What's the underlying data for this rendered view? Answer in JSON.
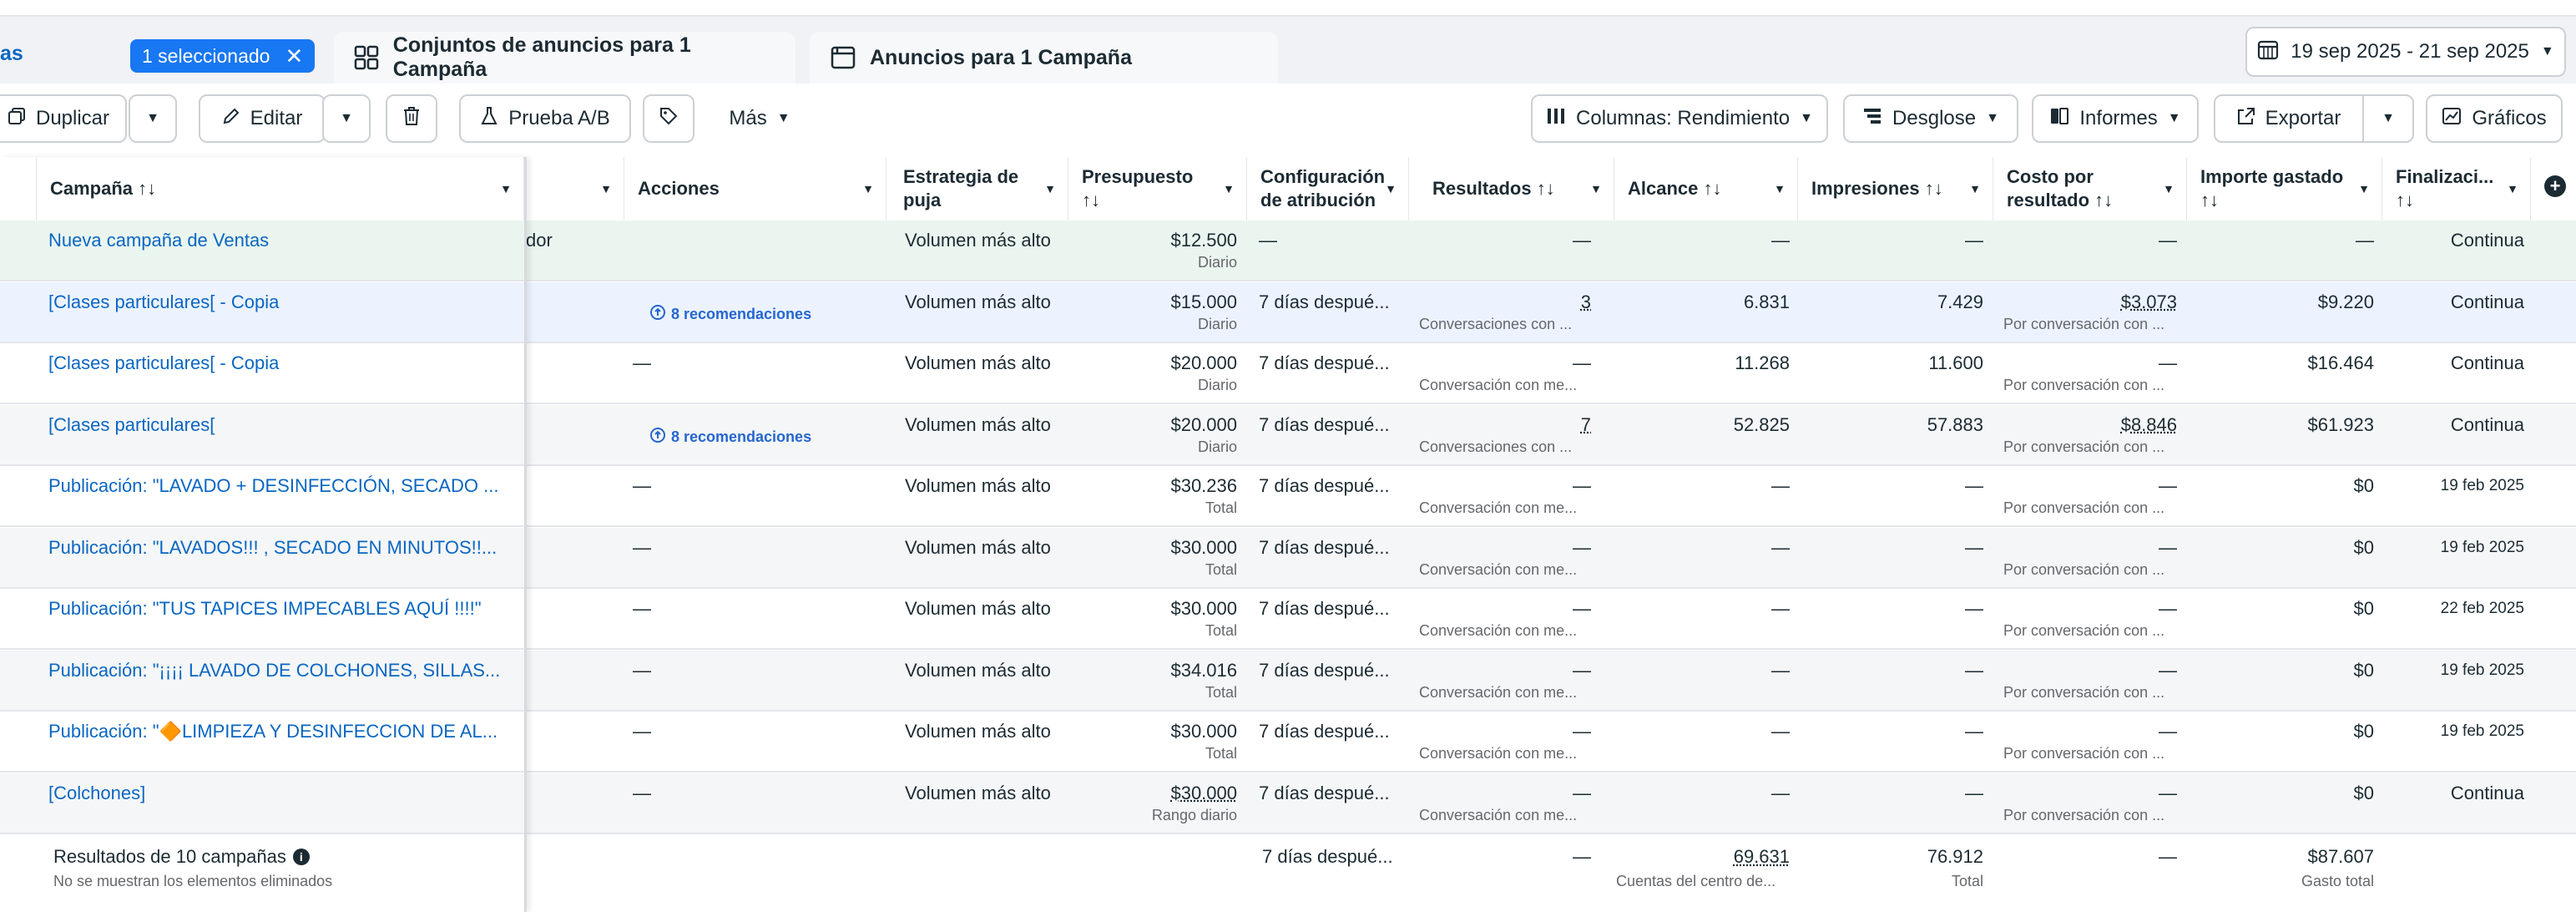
{
  "tabs": {
    "partial_label": "as",
    "selected_badge": "1 seleccionado",
    "ad_sets_tab": "Conjuntos de anuncios para 1 Campaña",
    "ads_tab": "Anuncios para 1 Campaña",
    "date_range": "19 sep 2025 - 21 sep 2025"
  },
  "toolbar": {
    "duplicate": "Duplicar",
    "edit": "Editar",
    "ab_test": "Prueba A/B",
    "more": "Más",
    "columns": "Columnas: Rendimiento",
    "breakdown": "Desglose",
    "reports": "Informes",
    "export": "Exportar",
    "charts": "Gráficos"
  },
  "headers": {
    "campaign": "Campaña ↑↓",
    "actions": "Acciones",
    "bid_strategy_1": "Estrategia de",
    "bid_strategy_2": "puja",
    "budget_1": "Presupuesto",
    "budget_2": "↑↓",
    "attribution_1": "Configuración",
    "attribution_2": "de atribución",
    "results": "Resultados ↑↓",
    "reach": "Alcance ↑↓",
    "impressions": "Impresiones ↑↓",
    "cost_1": "Costo por",
    "cost_2": "resultado ↑↓",
    "spent_1": "Importe gastado",
    "spent_2": "↑↓",
    "end_1": "Finalizaci...",
    "end_2": "↑↓"
  },
  "rows": [
    {
      "name": "Nueva campaña de Ventas",
      "hidden": "dor",
      "actions": "",
      "rec": "",
      "bid": "Volumen más alto",
      "budget": "$12.500",
      "budget_sub": "Diario",
      "attr": "—",
      "results": "—",
      "results_sub": "",
      "reach": "—",
      "impr": "—",
      "cost": "—",
      "cost_sub": "",
      "spent": "—",
      "end": "Continua"
    },
    {
      "name": "[Clases particulares[ - Copia",
      "hidden": "",
      "actions": "",
      "rec": "8 recomendaciones",
      "bid": "Volumen más alto",
      "budget": "$15.000",
      "budget_sub": "Diario",
      "attr": "7 días despué...",
      "results": "3",
      "results_sub": "Conversaciones con ...",
      "reach": "6.831",
      "impr": "7.429",
      "cost": "$3.073",
      "cost_sub": "Por conversación con ...",
      "spent": "$9.220",
      "end": "Continua"
    },
    {
      "name": "[Clases particulares[ - Copia",
      "hidden": "",
      "actions": "—",
      "rec": "",
      "bid": "Volumen más alto",
      "budget": "$20.000",
      "budget_sub": "Diario",
      "attr": "7 días despué...",
      "results": "—",
      "results_sub": "Conversación con me...",
      "reach": "11.268",
      "impr": "11.600",
      "cost": "—",
      "cost_sub": "Por conversación con ...",
      "spent": "$16.464",
      "end": "Continua"
    },
    {
      "name": "[Clases particulares[",
      "hidden": "",
      "actions": "",
      "rec": "8 recomendaciones",
      "bid": "Volumen más alto",
      "budget": "$20.000",
      "budget_sub": "Diario",
      "attr": "7 días despué...",
      "results": "7",
      "results_sub": "Conversaciones con ...",
      "reach": "52.825",
      "impr": "57.883",
      "cost": "$8.846",
      "cost_sub": "Por conversación con ...",
      "spent": "$61.923",
      "end": "Continua"
    },
    {
      "name": "Publicación: \"LAVADO + DESINFECCIÓN, SECADO ...",
      "hidden": "",
      "actions": "—",
      "rec": "",
      "bid": "Volumen más alto",
      "budget": "$30.236",
      "budget_sub": "Total",
      "attr": "7 días despué...",
      "results": "—",
      "results_sub": "Conversación con me...",
      "reach": "—",
      "impr": "—",
      "cost": "—",
      "cost_sub": "Por conversación con ...",
      "spent": "$0",
      "end": "19 feb 2025"
    },
    {
      "name": "Publicación: \"LAVADOS!!! , SECADO EN MINUTOS!!...",
      "hidden": "",
      "actions": "—",
      "rec": "",
      "bid": "Volumen más alto",
      "budget": "$30.000",
      "budget_sub": "Total",
      "attr": "7 días despué...",
      "results": "—",
      "results_sub": "Conversación con me...",
      "reach": "—",
      "impr": "—",
      "cost": "—",
      "cost_sub": "Por conversación con ...",
      "spent": "$0",
      "end": "19 feb 2025"
    },
    {
      "name": "Publicación: \"TUS TAPICES IMPECABLES AQUÍ !!!!\"",
      "hidden": "",
      "actions": "—",
      "rec": "",
      "bid": "Volumen más alto",
      "budget": "$30.000",
      "budget_sub": "Total",
      "attr": "7 días despué...",
      "results": "—",
      "results_sub": "Conversación con me...",
      "reach": "—",
      "impr": "—",
      "cost": "—",
      "cost_sub": "Por conversación con ...",
      "spent": "$0",
      "end": "22 feb 2025"
    },
    {
      "name": "Publicación: \"¡¡¡¡ LAVADO DE COLCHONES, SILLAS...",
      "hidden": "",
      "actions": "—",
      "rec": "",
      "bid": "Volumen más alto",
      "budget": "$34.016",
      "budget_sub": "Total",
      "attr": "7 días despué...",
      "results": "—",
      "results_sub": "Conversación con me...",
      "reach": "—",
      "impr": "—",
      "cost": "—",
      "cost_sub": "Por conversación con ...",
      "spent": "$0",
      "end": "19 feb 2025"
    },
    {
      "name": "Publicación: \"🔶LIMPIEZA Y DESINFECCION DE AL...",
      "hidden": "",
      "actions": "—",
      "rec": "",
      "bid": "Volumen más alto",
      "budget": "$30.000",
      "budget_sub": "Total",
      "attr": "7 días despué...",
      "results": "—",
      "results_sub": "Conversación con me...",
      "reach": "—",
      "impr": "—",
      "cost": "—",
      "cost_sub": "Por conversación con ...",
      "spent": "$0",
      "end": "19 feb 2025"
    },
    {
      "name": "[Colchones]",
      "hidden": "",
      "actions": "—",
      "rec": "",
      "bid": "Volumen más alto",
      "budget": "$30.000",
      "budget_sub": "Rango diario",
      "attr": "7 días despué...",
      "results": "—",
      "results_sub": "Conversación con me...",
      "reach": "—",
      "impr": "—",
      "cost": "—",
      "cost_sub": "Por conversación con ...",
      "spent": "$0",
      "end": "Continua"
    }
  ],
  "footer": {
    "title": "Resultados de 10 campañas",
    "note": "No se muestran los elementos eliminados",
    "attr": "7 días despué...",
    "results": "—",
    "reach": "69.631",
    "reach_sub": "Cuentas del centro de...",
    "impr": "76.912",
    "impr_sub": "Total",
    "cost": "—",
    "spent": "$87.607",
    "spent_sub": "Gasto total"
  }
}
